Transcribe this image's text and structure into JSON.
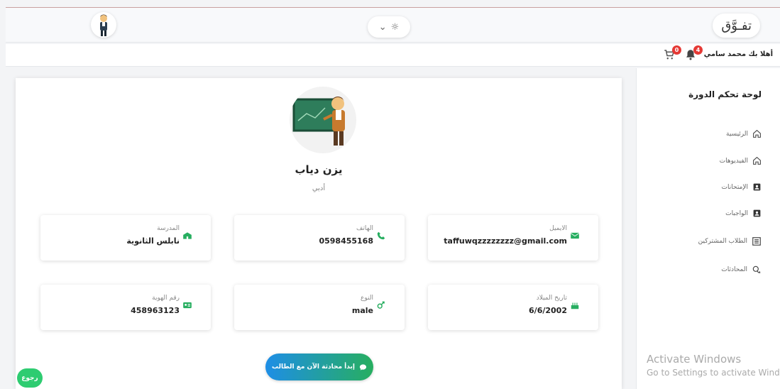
{
  "header": {
    "brand": "تفـوَّق",
    "theme_chevron": "⌄",
    "theme_icon": "☼"
  },
  "userbar": {
    "greeting": "أهلا بك محمد سامي",
    "notifications_count": "4",
    "cart_count": "0"
  },
  "sidebar": {
    "title": "لوحة تحكم الدورة",
    "items": [
      {
        "label": "الرئيسية",
        "icon": "home-icon"
      },
      {
        "label": "الفيديوهات",
        "icon": "home-icon"
      },
      {
        "label": "الإمتحانات",
        "icon": "account-box-icon"
      },
      {
        "label": "الواجبات",
        "icon": "account-box-icon"
      },
      {
        "label": "الطلاب المشتركين",
        "icon": "list-icon"
      },
      {
        "label": "المحادثات",
        "icon": "chat-bubbles-icon"
      }
    ]
  },
  "profile": {
    "name": "يزن دياب",
    "role": "أدبي"
  },
  "cards": {
    "email": {
      "label": "الايميل",
      "value": "taffuwqzzzzzzzz@gmail.com",
      "icon": "envelope-icon"
    },
    "phone": {
      "label": "الهاتف",
      "value": "0598455168",
      "icon": "phone-icon"
    },
    "school": {
      "label": "المدرسة",
      "value": "نابلس الثانوية",
      "icon": "school-icon"
    },
    "birthdate": {
      "label": "تاريخ الميلاد",
      "value": "6/6/2002",
      "icon": "cake-icon"
    },
    "gender": {
      "label": "النوع",
      "value": "male",
      "icon": "gender-icon"
    },
    "id_number": {
      "label": "رقم الهوية",
      "value": "458963123",
      "icon": "id-card-icon"
    }
  },
  "actions": {
    "start_chat": "إبدأ محادثة الآن مع الطالب",
    "back": "رجوع"
  },
  "watermark": {
    "line1": "Activate Windows",
    "line2": "Go to Settings to activate Windows."
  },
  "colors": {
    "accent_green": "#27ae60",
    "accent_blue": "#1e8ee6",
    "badge_red": "#e53935"
  }
}
